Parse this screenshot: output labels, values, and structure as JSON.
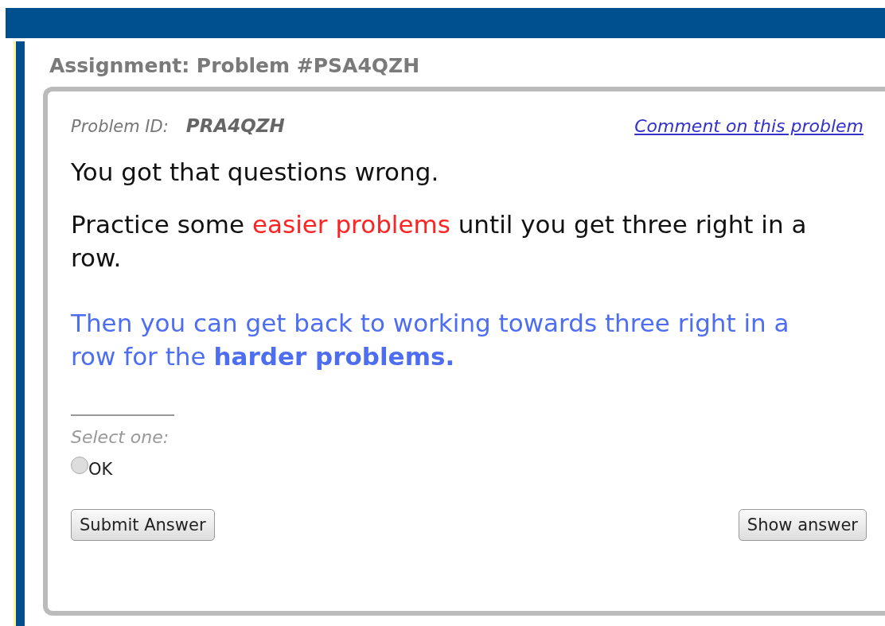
{
  "header": {
    "title": "Assignment: Problem #PSA4QZH"
  },
  "problem": {
    "id_label": "Problem ID:",
    "id": "PRA4QZH",
    "comment_link": "Comment on this problem",
    "paragraphs": [
      {
        "kind": "feedback",
        "parts": [
          {
            "text": "You got that questions wrong.",
            "highlight": false
          }
        ]
      },
      {
        "kind": "feedback",
        "parts": [
          {
            "text": "Practice some ",
            "highlight": false
          },
          {
            "text": "easier problems",
            "highlight": true
          },
          {
            "text": " until you get three right in a row.",
            "highlight": false
          }
        ]
      },
      {
        "kind": "hint",
        "parts": [
          {
            "text": "Then you can get back to working towards three right in a row for the **harder problems.**",
            "highlight": false
          }
        ]
      }
    ],
    "prompt": "Select one:",
    "options": [
      {
        "label": "OK",
        "selected": false
      }
    ],
    "buttons": [
      {
        "label": "Submit Answer"
      },
      {
        "label": "Show answer"
      }
    ]
  }
}
